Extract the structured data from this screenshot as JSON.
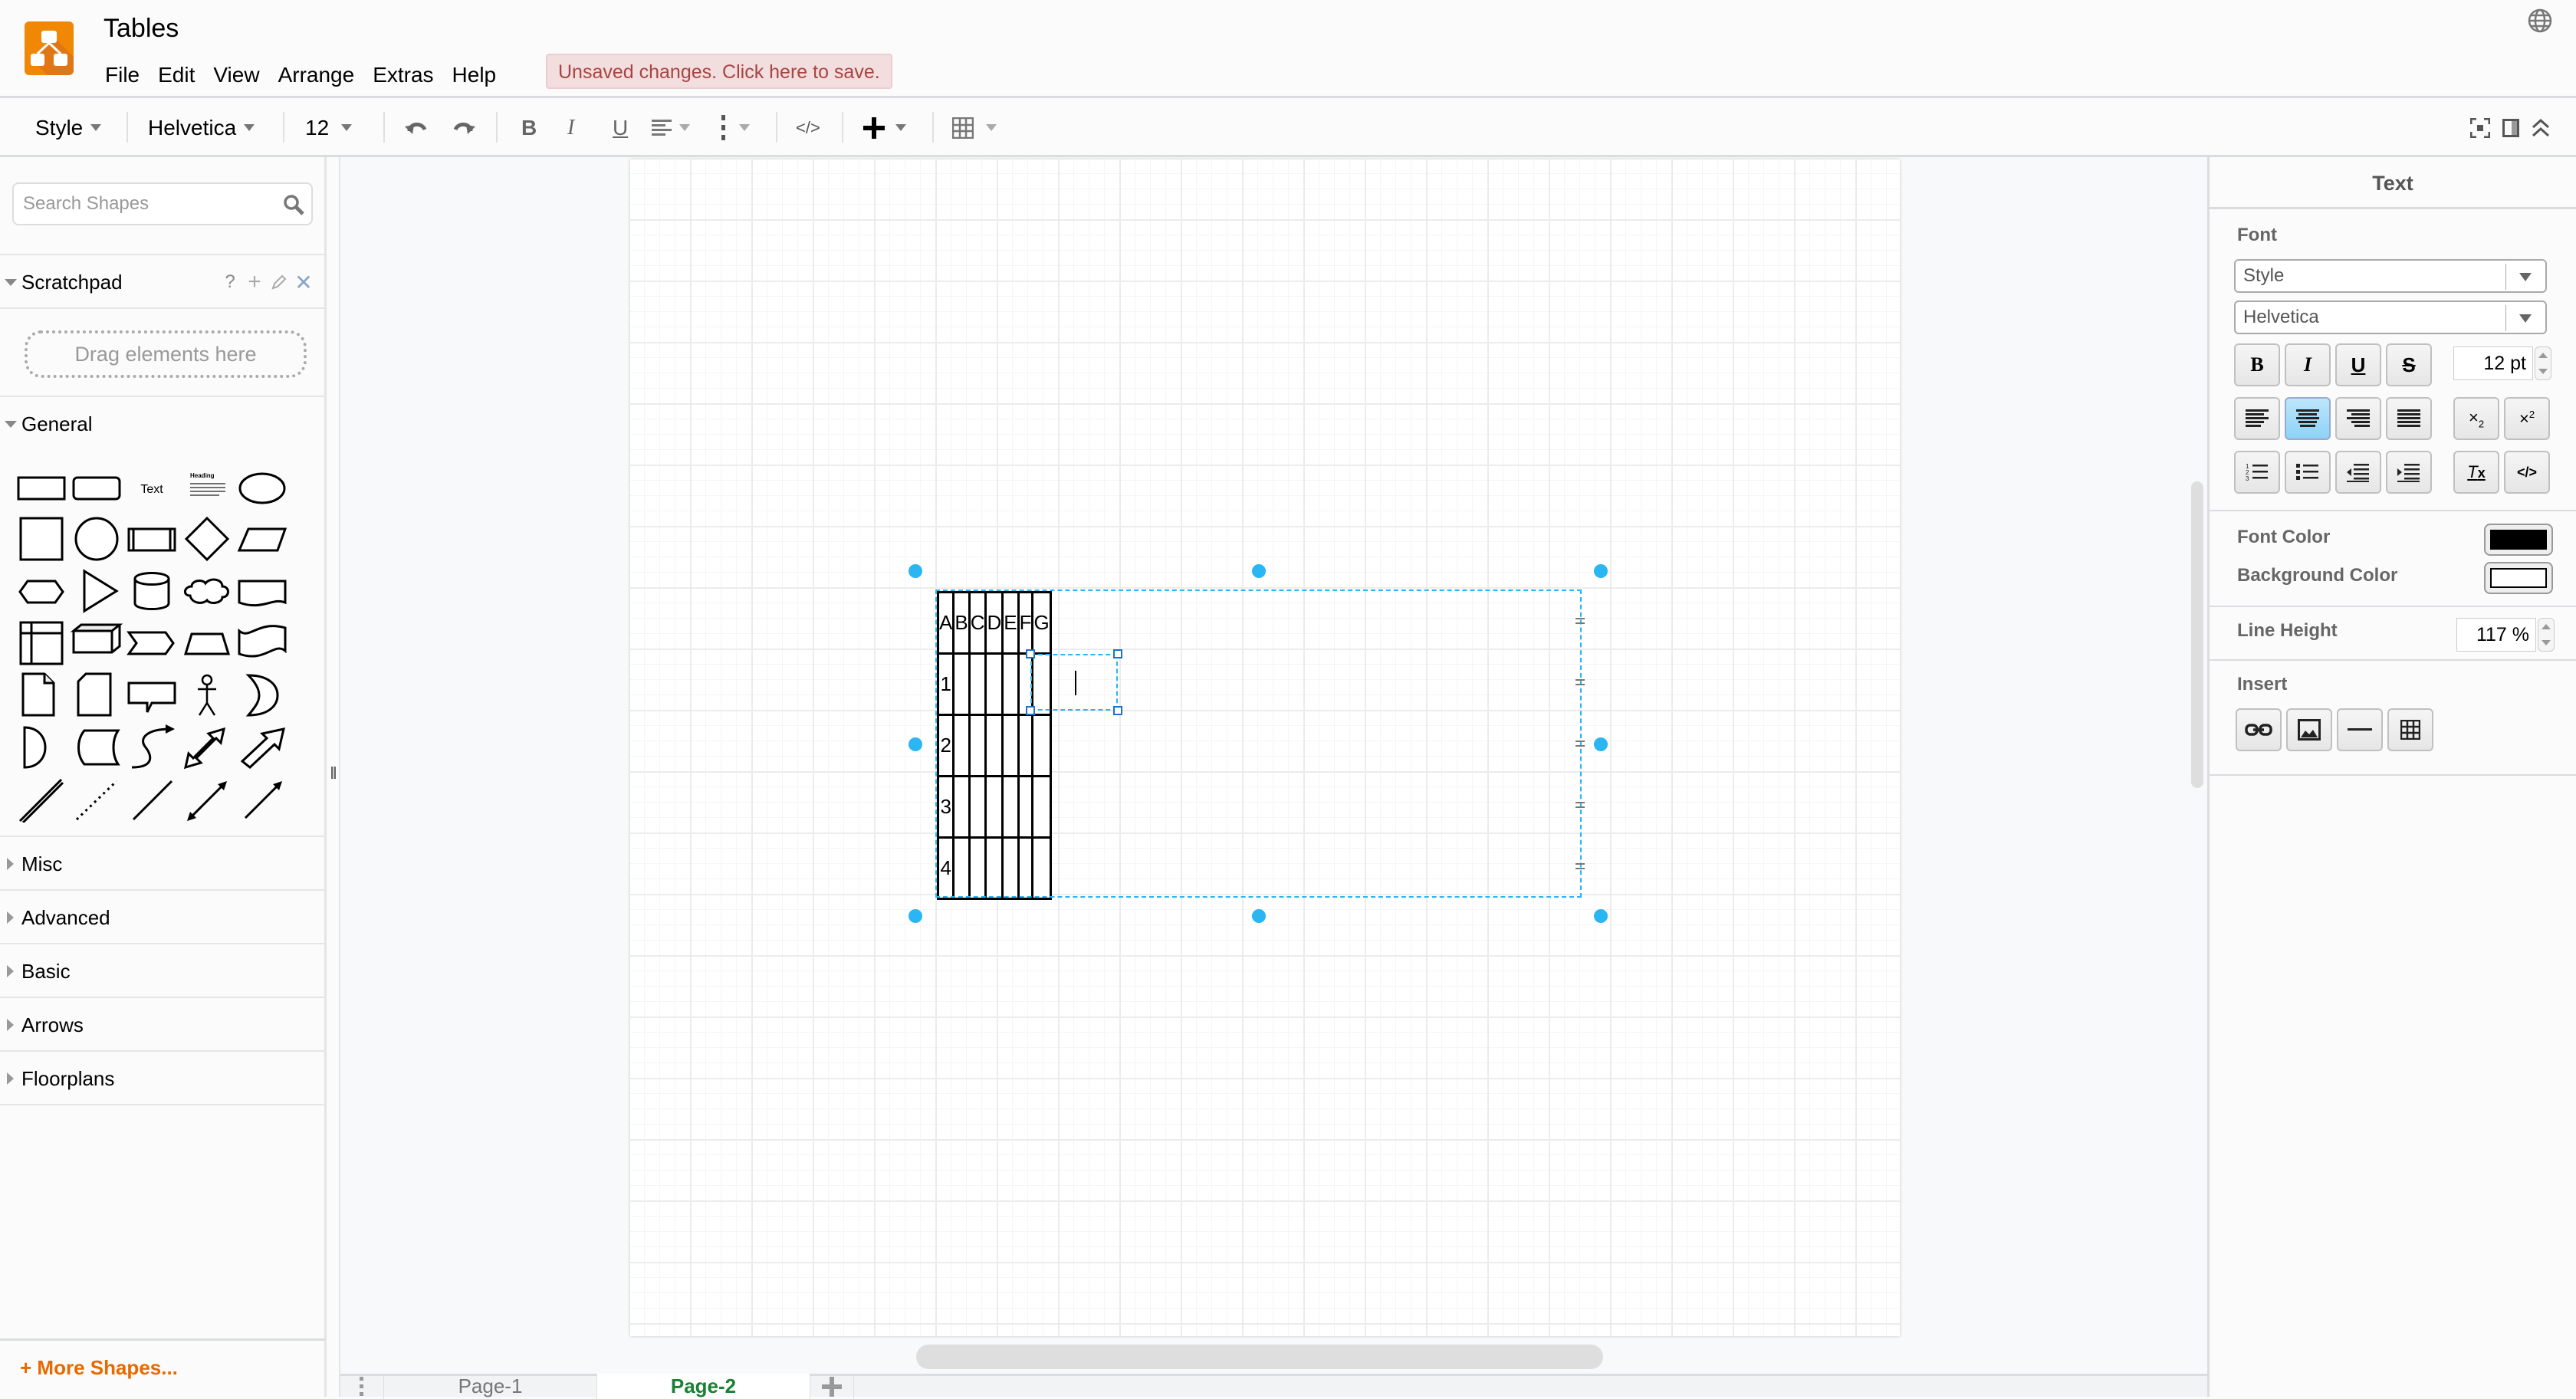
{
  "app": {
    "title": "Tables",
    "unsaved_notice": "Unsaved changes. Click here to save.",
    "menus": [
      "File",
      "Edit",
      "View",
      "Arrange",
      "Extras",
      "Help"
    ]
  },
  "toolbar": {
    "style_label": "Style",
    "font_label": "Helvetica",
    "font_size": "12",
    "icons": [
      "undo-icon",
      "redo-icon",
      "bold-icon",
      "italic-icon",
      "underline-icon",
      "align-icon",
      "vertical-align-icon",
      "html-icon",
      "insert-icon",
      "table-icon",
      "fullscreen-icon",
      "format-panel-icon",
      "collapse-icon"
    ]
  },
  "sidebar": {
    "search_placeholder": "Search Shapes",
    "scratchpad": {
      "label": "Scratchpad",
      "help": "?",
      "dropzone": "Drag elements here"
    },
    "general": {
      "label": "General",
      "shapes": [
        "rectangle",
        "rounded-rectangle",
        "text",
        "textbox",
        "ellipse",
        "square",
        "circle",
        "process",
        "diamond",
        "parallelogram",
        "hexagon",
        "triangle",
        "cylinder",
        "cloud",
        "document",
        "internal-storage",
        "cube",
        "step",
        "trapezoid",
        "tape",
        "note",
        "card",
        "callout",
        "actor",
        "or",
        "and",
        "data-storage",
        "curved-arrow",
        "bidirectional-arrow",
        "arrow",
        "link",
        "dotted-line",
        "line",
        "bidirectional-connector",
        "directional-connector"
      ],
      "text_shape_label": "Text",
      "heading_shape_label": "Heading"
    },
    "collapsed_sections": [
      "Misc",
      "Advanced",
      "Basic",
      "Arrows",
      "Floorplans"
    ],
    "more_shapes": "+ More Shapes..."
  },
  "canvas": {
    "table": {
      "columns": [
        "A",
        "B",
        "C",
        "D",
        "E",
        "F",
        "G"
      ],
      "rows": [
        [
          "",
          "",
          "",
          "",
          "",
          "",
          ""
        ],
        [
          "1",
          "",
          "",
          "",
          "",
          "",
          ""
        ],
        [
          "2",
          "",
          "",
          "",
          "",
          "",
          ""
        ],
        [
          "3",
          "",
          "",
          "",
          "",
          "",
          ""
        ],
        [
          "4",
          "",
          "",
          "",
          "",
          "",
          ""
        ]
      ],
      "editing_cell": "B1"
    }
  },
  "pages": {
    "tabs": [
      {
        "label": "Page-1",
        "active": false
      },
      {
        "label": "Page-2",
        "active": true
      }
    ]
  },
  "format_panel": {
    "title": "Text",
    "font_section": "Font",
    "style_select": "Style",
    "font_select": "Helvetica",
    "font_size": "12 pt",
    "font_color_label": "Font Color",
    "font_color": "#000000",
    "background_color_label": "Background Color",
    "background_color": "#FFFFFF",
    "line_height_label": "Line Height",
    "line_height": "117 %",
    "insert_label": "Insert",
    "text_align_active": "center"
  },
  "colors": {
    "accent": "#29b6f2",
    "brand": "#f08705",
    "active_tab": "#1a8033",
    "more_shapes": "#e66a00",
    "unsaved_text": "#a94442",
    "unsaved_bg": "#f2dede"
  }
}
